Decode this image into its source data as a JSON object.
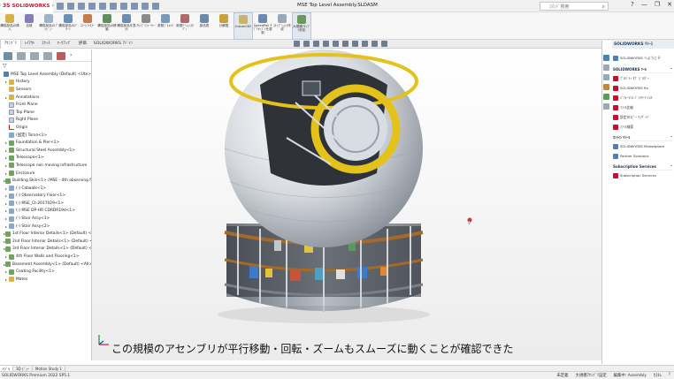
{
  "app": {
    "brand": "SOLIDWORKS",
    "window_title": "MSE Top Level Assembly.SLDASM",
    "search_placeholder": "ｺﾏﾝﾄﾞ検索",
    "win_controls": [
      "?",
      "—",
      "❐",
      "✕"
    ]
  },
  "ribbon": [
    {
      "label": "構成部品の挿入",
      "color": "#d6b24a"
    },
    {
      "label": "合致",
      "color": "#8a7ab8"
    },
    {
      "label": "構成部品のﾌﾟﾚﾋﾞｭｰ",
      "color": "#9db3c7"
    },
    {
      "label": "構成部品のﾊﾟﾀｰﾝ",
      "color": "#6b8fb5"
    },
    {
      "label": "ｽﾏｰﾄﾌｧｽﾅｰ",
      "color": "#c77a4a"
    },
    {
      "label": "構成部品の移動",
      "color": "#5e8f5e"
    },
    {
      "label": "構成部品を表示",
      "color": "#6f8bb0"
    },
    {
      "label": "ｱｾﾝﾌﾞﾘﾌｨｰﾁｬｰ",
      "color": "#8a8a8a"
    },
    {
      "label": "参照ｼﾞｵﾒﾄﾘ",
      "color": "#7a9ab8"
    },
    {
      "label": "新規ﾓｰｼｮﾝｽﾀﾃﾞｨ",
      "color": "#b06a6a"
    },
    {
      "label": "部品表",
      "color": "#6a8aa8"
    },
    {
      "label": "分解図",
      "color": "#c8a23a"
    },
    {
      "label": "Instant3D",
      "color": "#c8b46a",
      "active": true
    },
    {
      "label": "SpeedPak ｻﾌﾞｱｾﾝﾌﾞﾘを更新",
      "color": "#6a8ab0"
    },
    {
      "label": "ｽﾅｯﾌﾟｼｮｯﾄ作成",
      "color": "#9aa8b8"
    },
    {
      "label": "大規模ｱｾﾝﾌﾞﾘ設定",
      "color": "#6a9a5a",
      "active": true
    }
  ],
  "tabs": [
    "ｱｾﾝﾌﾞﾘ",
    "ﾚｲｱｳﾄ",
    "ｽｹｯﾁ",
    "ﾏｰｸｱｯﾌﾟ",
    "評価",
    "SOLIDWORKS ｱﾄﾞｲﾝ"
  ],
  "feature_tree": {
    "filter_icon": "▽",
    "root": "MSE Top Level Assembly (Default) <Ute>",
    "nodes": [
      {
        "label": "History",
        "icon": "folder",
        "exp": "▸"
      },
      {
        "label": "Sensors",
        "icon": "folder",
        "exp": ""
      },
      {
        "label": "Annotations",
        "icon": "folder",
        "exp": "▸"
      },
      {
        "label": "Front Plane",
        "icon": "plane",
        "exp": ""
      },
      {
        "label": "Top Plane",
        "icon": "plane",
        "exp": ""
      },
      {
        "label": "Right Plane",
        "icon": "plane",
        "exp": ""
      },
      {
        "label": "Origin",
        "icon": "origin",
        "exp": ""
      },
      {
        "label": "(固定) Torso<1>",
        "icon": "part",
        "exp": ""
      },
      {
        "label": "Foundation & Pier<1>",
        "icon": "asm",
        "exp": "▸"
      },
      {
        "label": "Structural Steel Assembly<1>",
        "icon": "asm",
        "exp": "▸"
      },
      {
        "label": "Telescope<1>",
        "icon": "asm",
        "exp": "▸"
      },
      {
        "label": "Telescope non moving infrastructure",
        "icon": "asm",
        "exp": "▸"
      },
      {
        "label": "Enclosure",
        "icon": "asm",
        "exp": "▸"
      },
      {
        "label": "Building Skin<1> (MSE - 4th observing fl",
        "icon": "asm",
        "exp": "▸"
      },
      {
        "label": "(-) Catwalk<1>",
        "icon": "part",
        "exp": "▸"
      },
      {
        "label": "(-) Observatory Floor<1>",
        "icon": "part",
        "exp": "▸"
      },
      {
        "label": "(-) MSE_Ct-2017029<1>",
        "icon": "part",
        "exp": "▸"
      },
      {
        "label": "(-) MSE DP-HR CDRDR19d<1>",
        "icon": "part",
        "exp": "▸"
      },
      {
        "label": "(-) Stair Assy<1>",
        "icon": "part",
        "exp": "▸"
      },
      {
        "label": "(-) Stair Assy<2>",
        "icon": "part",
        "exp": "▸"
      },
      {
        "label": "1st Floor Interior Details<1> (Default) <",
        "icon": "asm",
        "exp": "▸"
      },
      {
        "label": "2nd Floor Interior Details<1> (Default) <",
        "icon": "asm",
        "exp": "▸"
      },
      {
        "label": "3rd Floor Interior Details<1> (Default) <",
        "icon": "asm",
        "exp": "▸"
      },
      {
        "label": "4th Floor Walls and Flooring<1>",
        "icon": "asm",
        "exp": "▸"
      },
      {
        "label": "Basement Assembly<1> (Default) <All>",
        "icon": "asm",
        "exp": "▸"
      },
      {
        "label": "Coating Facility<1>",
        "icon": "asm",
        "exp": "▸"
      },
      {
        "label": "Mates",
        "icon": "folder",
        "exp": "▸"
      }
    ]
  },
  "viewport": {
    "subtitle": "この規模のアセンブリが平行移動・回転・ズームもスムーズに動くことが確認できた"
  },
  "task_pane": {
    "header": "SOLIDWORKS ﾘｿｰｽ",
    "welcome": "SOLIDWORKS へようこそ",
    "sections": [
      {
        "title": "SOLIDWORKS ﾂｰﾙ",
        "items": [
          "ﾌﾟﾛﾊﾟﾃｨ ﾀﾌﾞ ﾋﾞﾙﾀﾞｰ",
          "SOLIDWORKS Rx",
          "ﾊﾟﾌｫｰﾏﾝｽ ﾍﾞﾝﾁﾏｰｸ ﾃｽﾄ",
          "ﾌｧｲﾙ比較",
          "設定のｺﾋﾟｰ ｳｨｻﾞｰﾄﾞ",
          "ﾌｧｲﾙ検索"
        ]
      },
      {
        "title": "ｵﾝﾗｲﾝ ﾘｿｰｽ",
        "items": [
          "SOLIDWORKS Marketplace",
          "Partner Solutions"
        ]
      },
      {
        "title": "Subscription Services",
        "items": [
          "Subscription Services"
        ]
      }
    ]
  },
  "bottom_tabs": [
    "ﾓﾃﾞﾙ",
    "3D ﾋﾞｭｰ",
    "Motion Study 1"
  ],
  "status": {
    "left": "SOLIDWORKS Premium 2022 SP5.1",
    "right": [
      "未定義",
      "大規模ｱｾﾝﾌﾞﾘ設定",
      "編集中: Assembly",
      "ｶｽﾀﾑ",
      "?"
    ]
  }
}
